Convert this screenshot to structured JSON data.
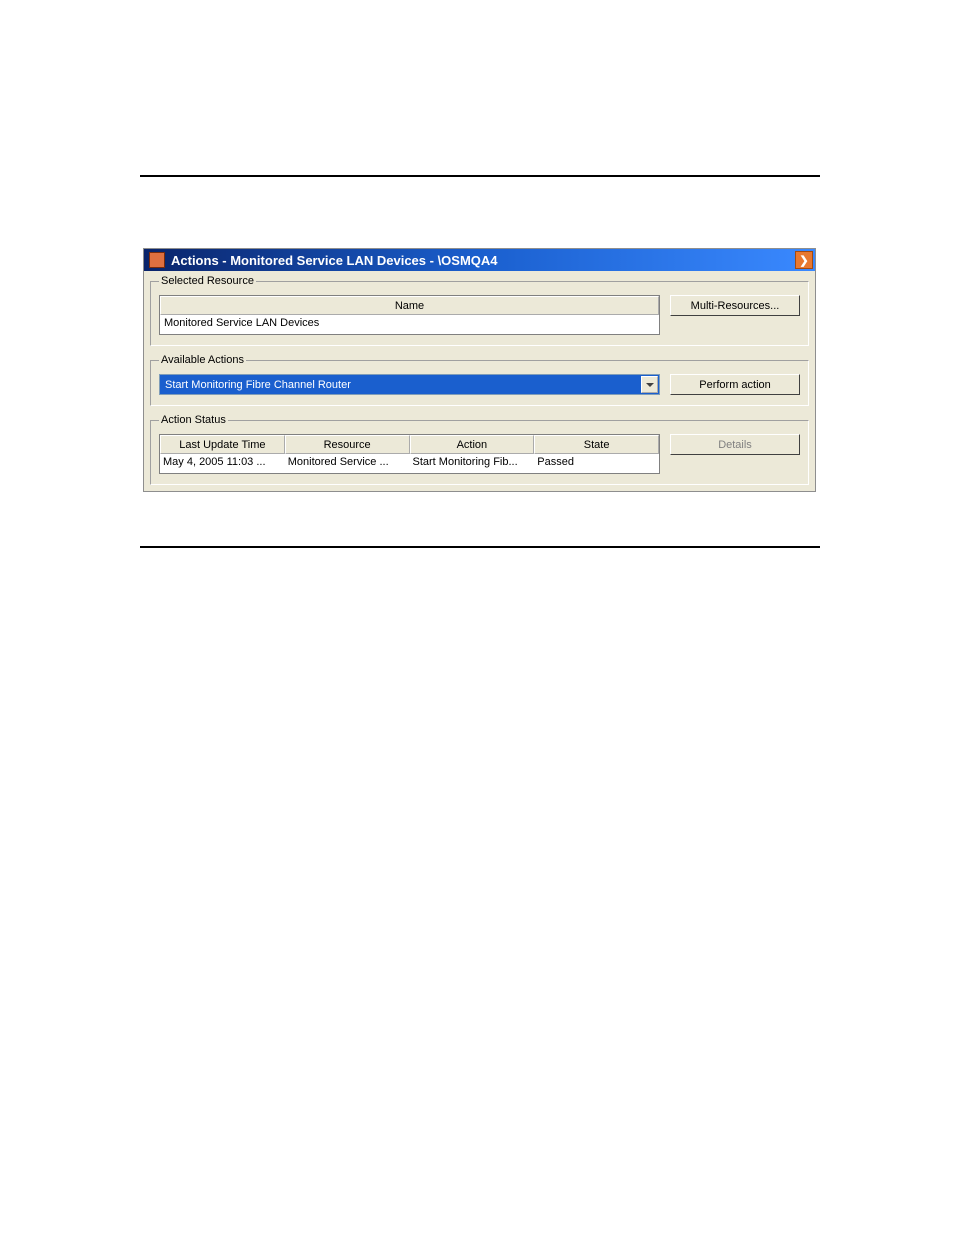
{
  "window": {
    "title": "Actions - Monitored Service LAN Devices - \\OSMQA4"
  },
  "selected_resource": {
    "legend": "Selected Resource",
    "name_header": "Name",
    "name_value": "Monitored Service LAN Devices",
    "multi_button": "Multi-Resources..."
  },
  "available_actions": {
    "legend": "Available Actions",
    "selected": "Start Monitoring Fibre Channel Router",
    "perform_button": "Perform action"
  },
  "action_status": {
    "legend": "Action Status",
    "headers": {
      "time": "Last Update Time",
      "resource": "Resource",
      "action": "Action",
      "state": "State"
    },
    "row": {
      "time": "May 4, 2005 11:03 ...",
      "resource": "Monitored Service ...",
      "action": "Start Monitoring Fib...",
      "state": "Passed"
    },
    "details_button": "Details"
  }
}
